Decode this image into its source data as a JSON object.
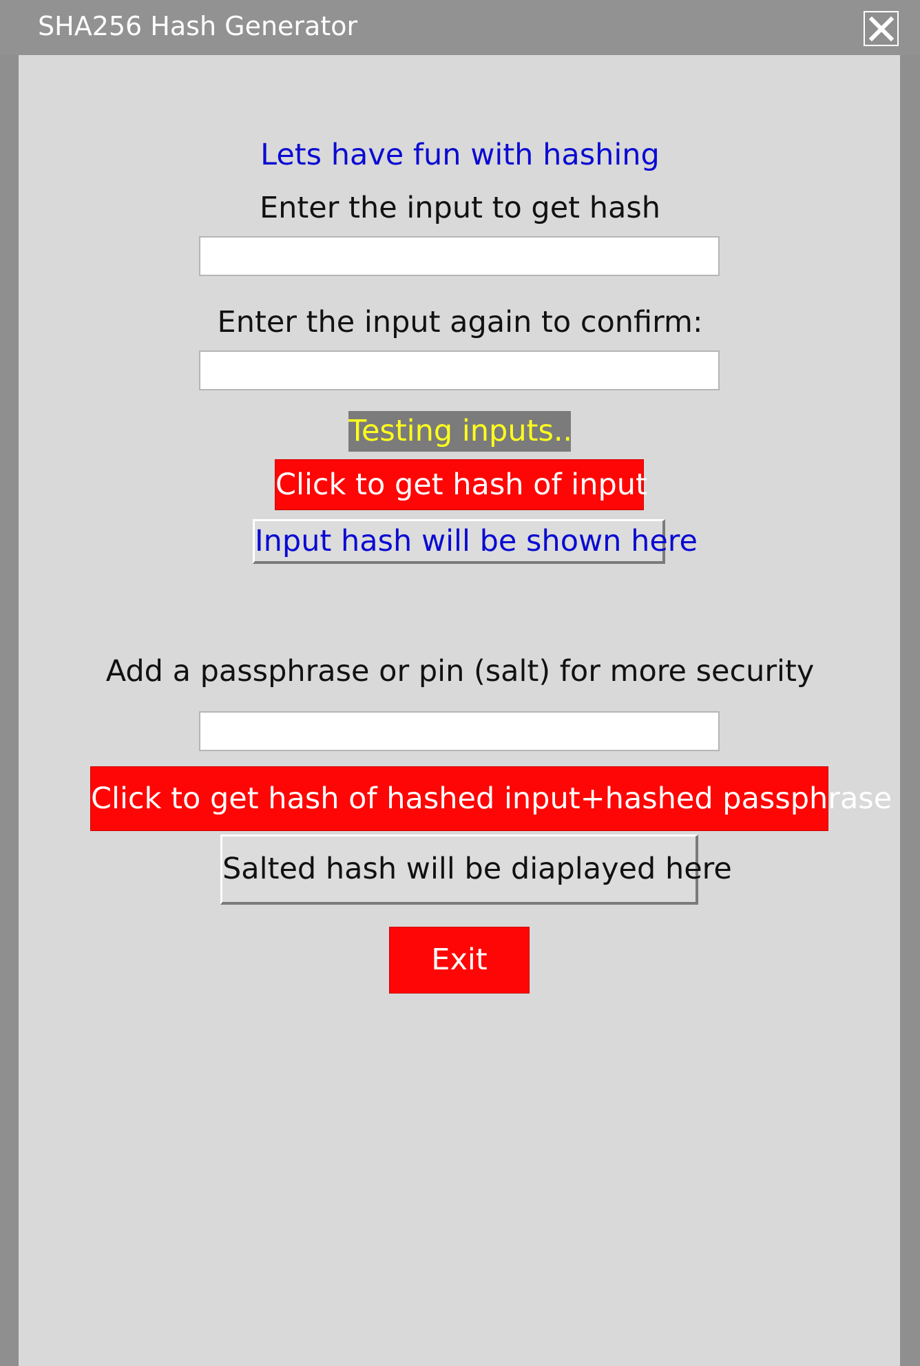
{
  "window": {
    "title": "SHA256 Hash Generator",
    "close_icon": "close-icon"
  },
  "main": {
    "heading": "Lets have fun with hashing",
    "input_label": "Enter the input to get hash",
    "input_value": "",
    "confirm_label": "Enter the input again to confirm:",
    "confirm_value": "",
    "status_text": "Testing inputs..",
    "hash_button_label": "Click to get  hash of input",
    "hash_result": "Input hash will be shown here",
    "salt_label": "Add a passphrase or pin (salt) for more security",
    "salt_value": "",
    "salted_button_label": "Click to get hash of hashed input+hashed passphrase",
    "salted_result": "Salted hash will be diaplayed here",
    "exit_button_label": "Exit"
  },
  "colors": {
    "heading": "#0a0ad2",
    "button_bg": "#ff0606",
    "status_bg": "#7b7b7b",
    "status_text": "#ffff1e",
    "client_bg": "#d9d9d9",
    "frame": "#8f8f8f"
  }
}
